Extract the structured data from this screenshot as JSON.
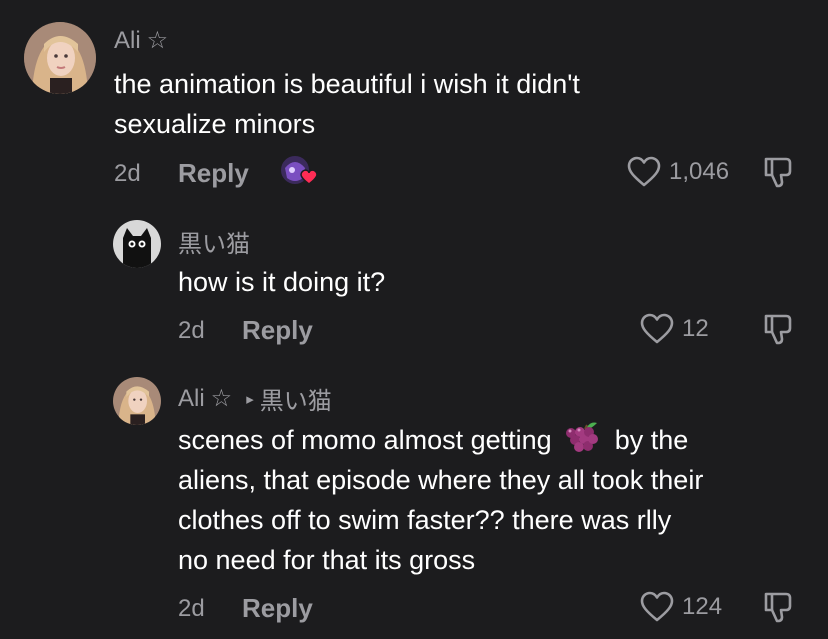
{
  "comments": [
    {
      "username": "Ali",
      "star": "☆",
      "text_lines": [
        "the animation is beautiful i wish it didn't",
        "sexualize minors"
      ],
      "age": "2d",
      "reply_label": "Reply",
      "likes": "1,046"
    },
    {
      "username": "黒い猫",
      "text_lines": [
        "how is it doing it?"
      ],
      "age": "2d",
      "reply_label": "Reply",
      "likes": "12"
    },
    {
      "username": "Ali",
      "star": "☆",
      "arrow": "▸",
      "reply_to": "黒い猫",
      "text_line1_before": "scenes of momo almost getting",
      "emoji": "grapes-emoji",
      "text_line1_after": "by the",
      "text_lines": [
        "aliens, that episode where they all took their",
        "clothes off to swim faster?? there was rlly",
        "no need for that its gross"
      ],
      "age": "2d",
      "reply_label": "Reply",
      "likes": "124"
    }
  ],
  "colors": {
    "background": "#1c1c1e",
    "text": "#ffffff",
    "muted": "#9c9ca1",
    "heart_badge": "#fe2c55"
  }
}
